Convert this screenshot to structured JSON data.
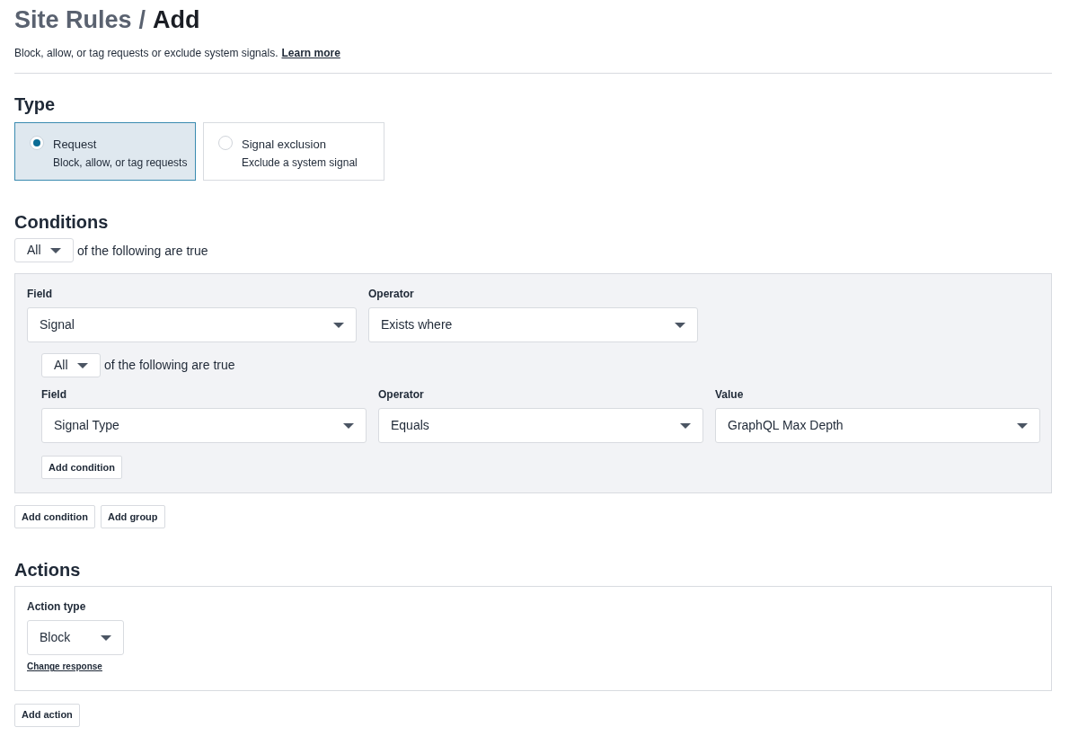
{
  "breadcrumb": {
    "parent": "Site Rules",
    "separator": "/",
    "current": "Add"
  },
  "description": {
    "text": "Block, allow, or tag requests or exclude system signals.",
    "link": "Learn more"
  },
  "type_section": {
    "heading": "Type",
    "options": [
      {
        "title": "Request",
        "subtitle": "Block, allow, or tag requests",
        "selected": true
      },
      {
        "title": "Signal exclusion",
        "subtitle": "Exclude a system signal",
        "selected": false
      }
    ]
  },
  "conditions": {
    "heading": "Conditions",
    "match": "All",
    "match_text": "of the following are true",
    "group": {
      "fields": [
        {
          "label": "Field",
          "value": "Signal"
        },
        {
          "label": "Operator",
          "value": "Exists where"
        }
      ],
      "subgroup": {
        "match": "All",
        "match_text": "of the following are true",
        "fields": [
          {
            "label": "Field",
            "value": "Signal Type"
          },
          {
            "label": "Operator",
            "value": "Equals"
          },
          {
            "label": "Value",
            "value": "GraphQL Max Depth"
          }
        ],
        "add_button": "Add condition"
      }
    },
    "buttons": [
      "Add condition",
      "Add group"
    ]
  },
  "actions": {
    "heading": "Actions",
    "action_type_label": "Action type",
    "action_type": "Block",
    "link": "Change response",
    "add_button": "Add action"
  }
}
